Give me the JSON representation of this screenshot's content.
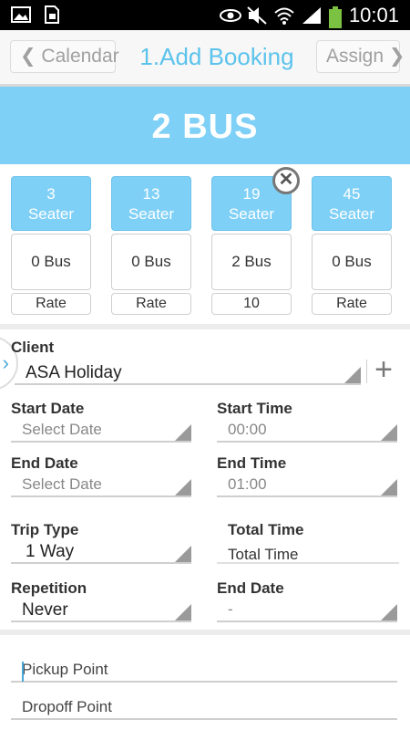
{
  "statusbar": {
    "time": "10:01",
    "icons_left": [
      "image-icon",
      "sim-icon"
    ],
    "icons_right": [
      "eye-icon",
      "mute-icon",
      "wifi-icon",
      "signal-icon",
      "battery-icon"
    ]
  },
  "actionbar": {
    "back_label": "❮ Calendar",
    "title": "1.Add Booking",
    "next_label": "Assign ❯"
  },
  "banner": {
    "text": "2 BUS"
  },
  "seaters": [
    {
      "seats": "3",
      "unit": "Seater",
      "bus": "0 Bus",
      "rate": "Rate"
    },
    {
      "seats": "13",
      "unit": "Seater",
      "bus": "0 Bus",
      "rate": "Rate"
    },
    {
      "seats": "19",
      "unit": "Seater",
      "bus": "2 Bus",
      "rate": "10"
    },
    {
      "seats": "45",
      "unit": "Seater",
      "bus": "0 Bus",
      "rate": "Rate"
    }
  ],
  "remove_badge": "✕",
  "form": {
    "client_label": "Client",
    "client_value": "ASA Holiday",
    "add_symbol": "+",
    "start_date_label": "Start Date",
    "start_date_value": "Select Date",
    "start_time_label": "Start Time",
    "start_time_value": "00:00",
    "end_date_label": "End Date",
    "end_date_value": "Select Date",
    "end_time_label": "End Time",
    "end_time_value": "01:00",
    "trip_type_label": "Trip Type",
    "trip_type_value": "1 Way",
    "total_time_label": "Total Time",
    "total_time_value": "Total Time",
    "repetition_label": "Repetition",
    "repetition_value": "Never",
    "end_date2_label": "End Date",
    "end_date2_value": "-",
    "pickup_placeholder": "Pickup Point",
    "dropoff_placeholder": "Dropoff Point"
  },
  "colors": {
    "accent": "#7fd0f7",
    "title": "#5bc3ec"
  }
}
